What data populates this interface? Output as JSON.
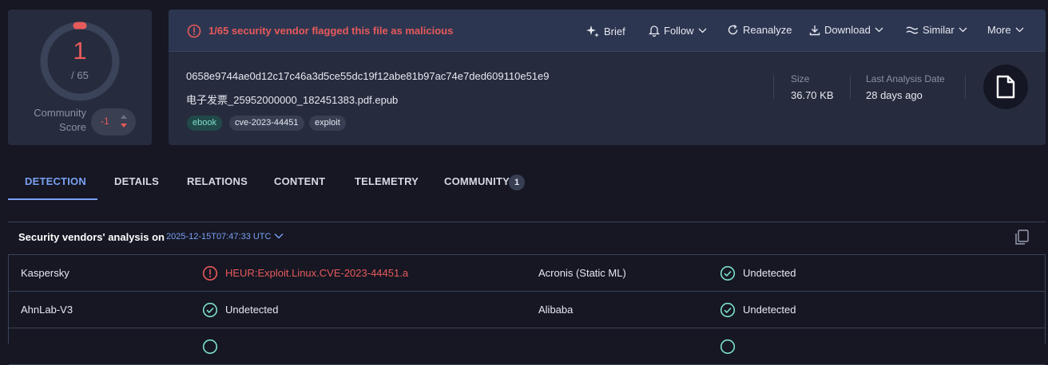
{
  "score": {
    "detections": "1",
    "total": "/ 65",
    "community_label_1": "Community",
    "community_label_2": "Score",
    "community_value": "-1"
  },
  "header": {
    "alert": "1/65 security vendor flagged this file as malicious",
    "actions": {
      "brief": "Brief",
      "follow": "Follow",
      "reanalyze": "Reanalyze",
      "download": "Download",
      "similar": "Similar",
      "more": "More"
    },
    "sha256": "0658e9744ae0d12c17c46a3d5ce55dc19f12abe81b97ac74e7ded609110e51e9",
    "filename": "电子发票_25952000000_182451383.pdf.epub",
    "tags": [
      "ebook",
      "cve-2023-44451",
      "exploit"
    ],
    "size_label": "Size",
    "size_value": "36.70 KB",
    "last_analysis_label": "Last Analysis Date",
    "last_analysis_value": "28 days ago",
    "filetype_icon": "document-icon"
  },
  "tabs": {
    "detection": "DETECTION",
    "details": "DETAILS",
    "relations": "RELATIONS",
    "content": "CONTENT",
    "telemetry": "TELEMETRY",
    "community": "COMMUNITY",
    "community_count": "1"
  },
  "detection": {
    "title": "Security vendors' analysis on",
    "date": "2025-12-15T07:47:33 UTC",
    "rows": [
      {
        "left_vendor": "Kaspersky",
        "left_result": "HEUR:Exploit.Linux.CVE-2023-44451.a",
        "left_status": "malicious",
        "right_vendor": "Acronis (Static ML)",
        "right_result": "Undetected",
        "right_status": "undetected"
      },
      {
        "left_vendor": "AhnLab-V3",
        "left_result": "Undetected",
        "left_status": "undetected",
        "right_vendor": "Alibaba",
        "right_result": "Undetected",
        "right_status": "undetected"
      }
    ]
  },
  "colors": {
    "background": "#161723",
    "card": "#262c3e",
    "accent": "#7aa0f2",
    "danger": "#e75a5a",
    "success": "#7de0c9"
  }
}
